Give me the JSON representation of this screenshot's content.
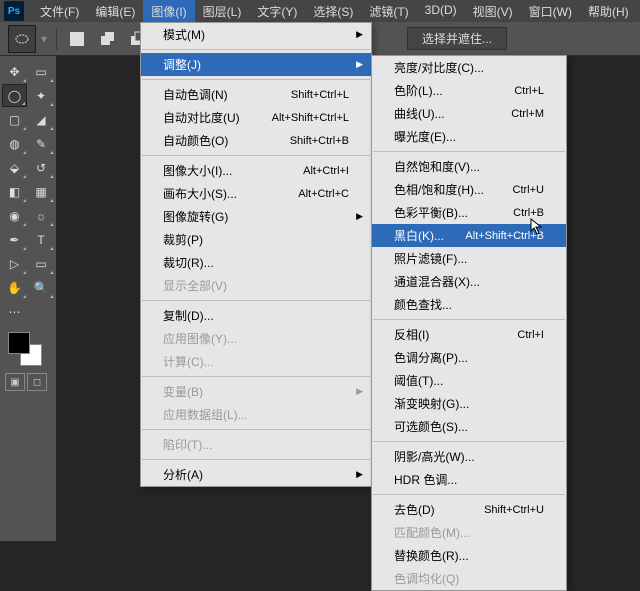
{
  "menubar": {
    "items": [
      "文件(F)",
      "编辑(E)",
      "图像(I)",
      "图层(L)",
      "文字(Y)",
      "选择(S)",
      "滤镜(T)",
      "3D(D)",
      "视图(V)",
      "窗口(W)",
      "帮助(H)"
    ],
    "active_index": 2
  },
  "toolbar": {
    "select_mask": "选择并遮住..."
  },
  "dd1": [
    {
      "t": "模式(M)",
      "sub": true
    },
    {
      "sep": true
    },
    {
      "t": "调整(J)",
      "sub": true,
      "hover": true
    },
    {
      "sep": true
    },
    {
      "t": "自动色调(N)",
      "k": "Shift+Ctrl+L"
    },
    {
      "t": "自动对比度(U)",
      "k": "Alt+Shift+Ctrl+L"
    },
    {
      "t": "自动颜色(O)",
      "k": "Shift+Ctrl+B"
    },
    {
      "sep": true
    },
    {
      "t": "图像大小(I)...",
      "k": "Alt+Ctrl+I"
    },
    {
      "t": "画布大小(S)...",
      "k": "Alt+Ctrl+C"
    },
    {
      "t": "图像旋转(G)",
      "sub": true
    },
    {
      "t": "裁剪(P)"
    },
    {
      "t": "裁切(R)..."
    },
    {
      "t": "显示全部(V)",
      "dis": true
    },
    {
      "sep": true
    },
    {
      "t": "复制(D)..."
    },
    {
      "t": "应用图像(Y)...",
      "dis": true
    },
    {
      "t": "计算(C)...",
      "dis": true
    },
    {
      "sep": true
    },
    {
      "t": "变量(B)",
      "sub": true,
      "dis": true
    },
    {
      "t": "应用数据组(L)...",
      "dis": true
    },
    {
      "sep": true
    },
    {
      "t": "陷印(T)...",
      "dis": true
    },
    {
      "sep": true
    },
    {
      "t": "分析(A)",
      "sub": true
    }
  ],
  "dd2": [
    {
      "t": "亮度/对比度(C)..."
    },
    {
      "t": "色阶(L)...",
      "k": "Ctrl+L"
    },
    {
      "t": "曲线(U)...",
      "k": "Ctrl+M"
    },
    {
      "t": "曝光度(E)..."
    },
    {
      "sep": true
    },
    {
      "t": "自然饱和度(V)..."
    },
    {
      "t": "色相/饱和度(H)...",
      "k": "Ctrl+U"
    },
    {
      "t": "色彩平衡(B)...",
      "k": "Ctrl+B"
    },
    {
      "t": "黑白(K)...",
      "k": "Alt+Shift+Ctrl+B",
      "hover": true
    },
    {
      "t": "照片滤镜(F)..."
    },
    {
      "t": "通道混合器(X)..."
    },
    {
      "t": "颜色查找..."
    },
    {
      "sep": true
    },
    {
      "t": "反相(I)",
      "k": "Ctrl+I"
    },
    {
      "t": "色调分离(P)..."
    },
    {
      "t": "阈值(T)..."
    },
    {
      "t": "渐变映射(G)..."
    },
    {
      "t": "可选颜色(S)..."
    },
    {
      "sep": true
    },
    {
      "t": "阴影/高光(W)..."
    },
    {
      "t": "HDR 色调..."
    },
    {
      "sep": true
    },
    {
      "t": "去色(D)",
      "k": "Shift+Ctrl+U"
    },
    {
      "t": "匹配颜色(M)...",
      "dis": true
    },
    {
      "t": "替换颜色(R)..."
    },
    {
      "t": "色调均化(Q)",
      "dis": true
    }
  ]
}
